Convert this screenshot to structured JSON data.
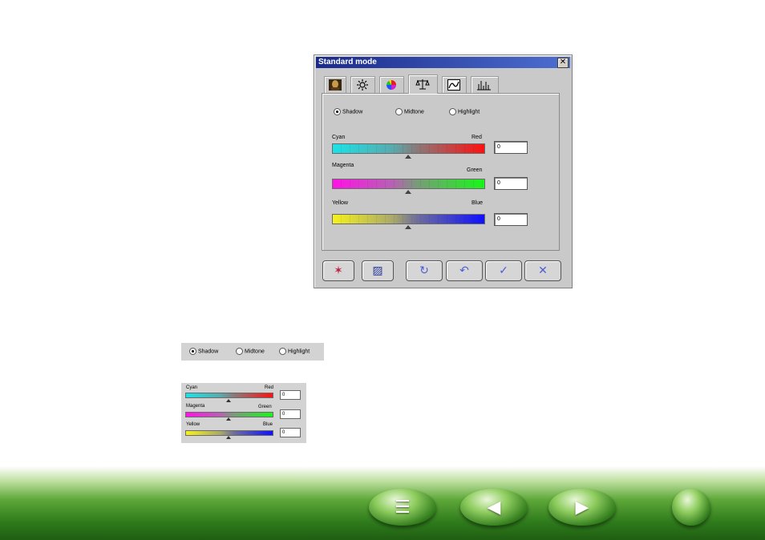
{
  "dialog": {
    "title": "Standard mode",
    "close_label": "✕",
    "tabs": [
      {
        "name": "image",
        "icon": "portrait-icon"
      },
      {
        "name": "brightness",
        "icon": "sun-icon"
      },
      {
        "name": "color",
        "icon": "color-wheel-icon"
      },
      {
        "name": "color-balance",
        "icon": "balance-scale-icon"
      },
      {
        "name": "curves",
        "icon": "curve-icon"
      },
      {
        "name": "levels",
        "icon": "histogram-icon"
      }
    ],
    "active_tab": 3,
    "radios": [
      {
        "label": "Shadow",
        "checked": true
      },
      {
        "label": "Midtone",
        "checked": false
      },
      {
        "label": "Highlight",
        "checked": false
      }
    ],
    "sliders": [
      {
        "left": "Cyan",
        "right": "Red",
        "value": "0",
        "level": 0
      },
      {
        "left": "Magenta",
        "right": "Green",
        "value": "0",
        "level": 0
      },
      {
        "left": "Yellow",
        "right": "Blue",
        "value": "0",
        "level": 0
      }
    ],
    "buttons": [
      {
        "name": "auto-adjust",
        "icon": "magic-wand-icon",
        "glyph": "✶"
      },
      {
        "name": "load-settings",
        "icon": "document-icon",
        "glyph": "▨"
      },
      {
        "name": "reset",
        "icon": "refresh-icon",
        "glyph": "↻"
      },
      {
        "name": "undo",
        "icon": "undo-icon",
        "glyph": "↶"
      },
      {
        "name": "ok",
        "icon": "check-icon",
        "glyph": "✓"
      },
      {
        "name": "cancel",
        "icon": "x-icon",
        "glyph": "✕"
      }
    ]
  },
  "crop_radios": {
    "items": [
      {
        "label": "Shadow",
        "checked": true
      },
      {
        "label": "Midtone",
        "checked": false
      },
      {
        "label": "Highlight",
        "checked": false
      }
    ]
  },
  "crop_sliders": {
    "items": [
      {
        "left": "Cyan",
        "right": "Red",
        "value": "0"
      },
      {
        "left": "Magenta",
        "right": "Green",
        "value": "0"
      },
      {
        "left": "Yellow",
        "right": "Blue",
        "value": "0"
      }
    ]
  },
  "nav": [
    {
      "name": "contents",
      "icon": "list-icon",
      "glyph": "☰"
    },
    {
      "name": "previous",
      "icon": "triangle-left-icon",
      "glyph": "◀"
    },
    {
      "name": "next",
      "icon": "triangle-right-icon",
      "glyph": "▶"
    },
    {
      "name": "home",
      "icon": "circle-icon",
      "glyph": ""
    }
  ],
  "colors": {
    "titlebar_start": "#1a2a8a",
    "titlebar_end": "#4e6fd0",
    "dialog_bg": "#c9c9c9",
    "footer_green": "#2f7c1c"
  }
}
